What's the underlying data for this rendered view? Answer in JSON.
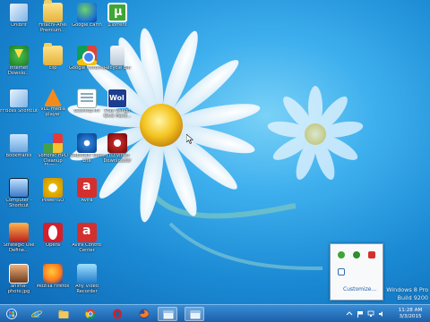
{
  "desktop": {
    "icons": [
      {
        "label": "UniBrit",
        "icon": "app-icon",
        "glyph": "g-app"
      },
      {
        "label": "Hitachi-Ariel Premium...",
        "icon": "folder-icon",
        "glyph": "g-folder"
      },
      {
        "label": "Google Earth",
        "icon": "google-earth-icon",
        "glyph": "g-earth"
      },
      {
        "label": "µTorrent",
        "icon": "utorrent-icon",
        "glyph": "g-utorrent"
      },
      {
        "label": "Internet Downlo...",
        "icon": "idm-icon",
        "glyph": "g-idm"
      },
      {
        "label": "clip",
        "icon": "folder-icon",
        "glyph": "g-folder"
      },
      {
        "label": "Google Chrome",
        "icon": "chrome-icon",
        "glyph": "g-chrome"
      },
      {
        "label": "Recycle Bin",
        "icon": "recycle-bin-icon",
        "glyph": "g-recycle"
      },
      {
        "label": "FFBoss Shortcut",
        "icon": "app-icon",
        "glyph": "g-app"
      },
      {
        "label": "VLC media player",
        "icon": "vlc-icon",
        "glyph": "g-vlc"
      },
      {
        "label": "desktop.ini",
        "icon": "document-icon",
        "glyph": "g-doc"
      },
      {
        "label": "Play Wingo Give Hard...",
        "icon": "wol-icon",
        "glyph": "g-wol"
      },
      {
        "label": "Bookmarks",
        "icon": "bookmark-icon",
        "glyph": "g-bookmark"
      },
      {
        "label": "Softonic HPD Cleanup Manu...",
        "icon": "picasa-icon",
        "glyph": "g-picasa"
      },
      {
        "label": "DAEMON Tools Lite",
        "icon": "daemon-tools-icon",
        "glyph": "g-daemon"
      },
      {
        "label": "YTD Video Downloader",
        "icon": "ytd-icon",
        "glyph": "g-ytd"
      },
      {
        "label": "Computer - Shortcut",
        "icon": "computer-icon",
        "glyph": "g-computer"
      },
      {
        "label": "PowerISO",
        "icon": "poweriso-icon",
        "glyph": "g-power"
      },
      {
        "label": "Avira",
        "icon": "avira-icon",
        "glyph": "g-avira"
      },
      {
        "label": "",
        "icon": "blank-icon",
        "glyph": ""
      },
      {
        "label": "Strategic Use Define...",
        "icon": "app-icon",
        "glyph": "g-stick"
      },
      {
        "label": "Opera",
        "icon": "opera-icon",
        "glyph": "g-opera"
      },
      {
        "label": "Avira Control Center",
        "icon": "avira-icon",
        "glyph": "g-avira"
      },
      {
        "label": "",
        "icon": "blank-icon",
        "glyph": ""
      },
      {
        "label": "anima-photo.jpg",
        "icon": "photo-icon",
        "glyph": "g-photo"
      },
      {
        "label": "Mozilla Firefox",
        "icon": "firefox-icon",
        "glyph": "g-firefox"
      },
      {
        "label": "Any Video Recorder",
        "icon": "any-video-icon",
        "glyph": "g-anyvideo"
      }
    ]
  },
  "tray_popup": {
    "customize_label": "Customize..."
  },
  "watermark": {
    "line1": "Windows 8 Pro",
    "line2": "Build 9200"
  },
  "taskbar": {
    "clock_time": "11:28 AM",
    "clock_date": "3/3/2015",
    "buttons": [
      {
        "name": "start",
        "icon": "windows-icon"
      },
      {
        "name": "internet-explorer",
        "icon": "ie-icon"
      },
      {
        "name": "file-explorer",
        "icon": "folder-icon"
      },
      {
        "name": "chrome",
        "icon": "chrome-icon"
      },
      {
        "name": "opera",
        "icon": "opera-icon"
      },
      {
        "name": "firefox",
        "icon": "firefox-icon"
      },
      {
        "name": "app1",
        "icon": "window-icon"
      },
      {
        "name": "app2",
        "icon": "window-icon"
      }
    ]
  },
  "colors": {
    "accent": "#1b5fa8",
    "wallpaper": "#1e8fd6"
  }
}
